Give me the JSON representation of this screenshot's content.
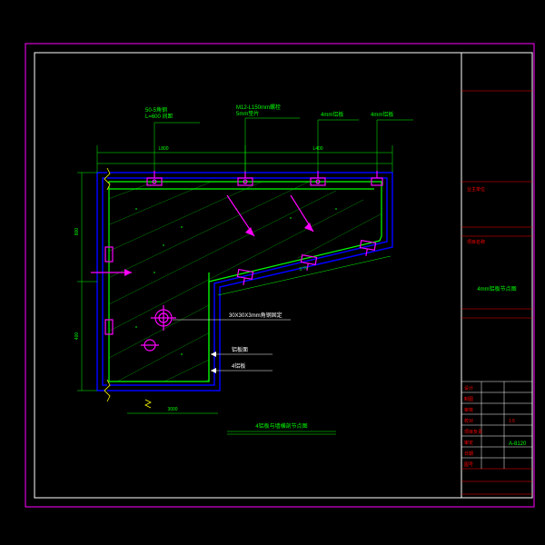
{
  "dims": {
    "top1": "L800",
    "top2": "L400",
    "left1": "800",
    "left2": "400",
    "bottom_angle": "5°%",
    "bottom_span": "3000"
  },
  "labels": {
    "l1": "50-5角钢\\nL=600 间距",
    "l2": "M12-L150mm螺栓\\n5mm垫片",
    "l3": "4mm铝板",
    "l4": "4mm铝板",
    "l5": "30X30X3mm角钢固定",
    "l6": "铝板面",
    "l7": "4铝板"
  },
  "title": "4铝板与墙横剖节点图",
  "titleblock": {
    "owner": "业主单位",
    "project": "项目名称",
    "dwg_title": "4mm铝板节点图",
    "scale": "1:5",
    "sheet": "A-8120",
    "rows": [
      "设计",
      "制图",
      "审核",
      "校对",
      "项目负责",
      "审定",
      "日期",
      "图号"
    ]
  }
}
